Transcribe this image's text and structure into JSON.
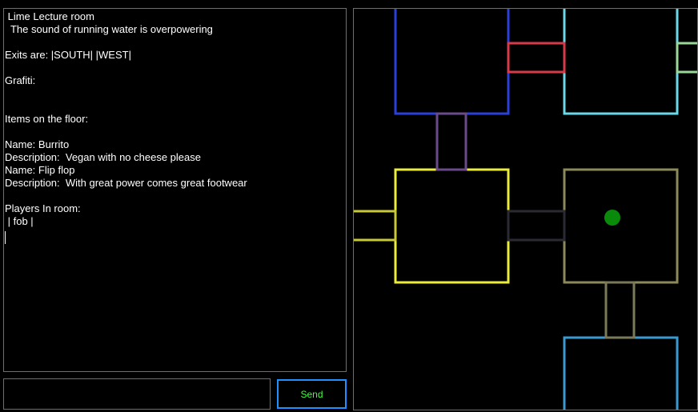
{
  "output": {
    "lines": [
      " Lime Lecture room",
      "  The sound of running water is overpowering",
      "",
      "Exits are: |SOUTH| |WEST|",
      "",
      "Grafiti:",
      "",
      "",
      "Items on the floor:",
      "",
      "Name: Burrito",
      "Description:  Vegan with no cheese please",
      "Name: Flip flop",
      "Description:  With great power comes great footwear",
      "",
      "Players In room:",
      " | fob |"
    ]
  },
  "input": {
    "value": ""
  },
  "send_button": {
    "label": "Send"
  },
  "map": {
    "rooms": [
      {
        "name": "north-room",
        "color": "#2a40d8"
      },
      {
        "name": "northeast-room",
        "color": "#6ad8e8"
      },
      {
        "name": "west-room-yellow",
        "color": "#ecec3a"
      },
      {
        "name": "current-room",
        "color": "#8a8a5a"
      },
      {
        "name": "south-room",
        "color": "#3a9ad0"
      }
    ],
    "corridors": [
      {
        "name": "red-corridor",
        "color": "#d83a4a"
      },
      {
        "name": "green-corridor",
        "color": "#9ad89a"
      },
      {
        "name": "purple-corridor",
        "color": "#6a4a8a"
      },
      {
        "name": "yellow-corridor",
        "color": "#c8c83a"
      },
      {
        "name": "dark-corridor",
        "color": "#2a2a34"
      },
      {
        "name": "olive-corridor",
        "color": "#7a7a5a"
      }
    ],
    "player_marker": {
      "color": "#0a8a0a"
    }
  }
}
